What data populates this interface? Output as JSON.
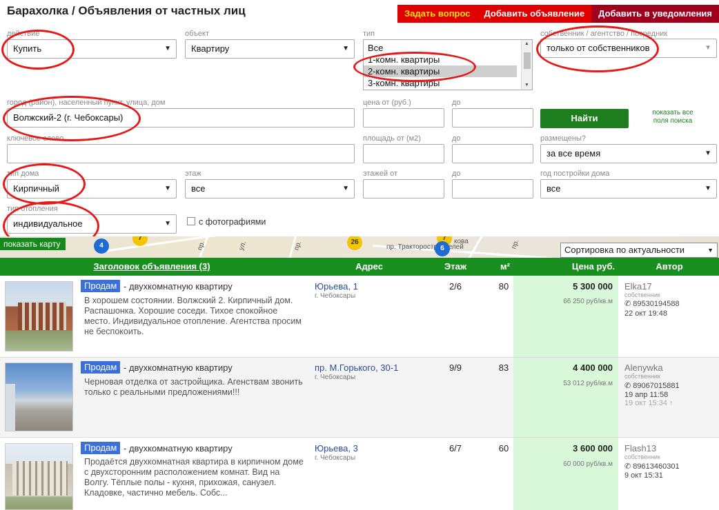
{
  "header": {
    "title": "Барахолка / Объявления от частных лиц",
    "buttons": {
      "ask": "Задать вопрос",
      "add": "Добавить объявление",
      "notify": "Добавить в уведомления"
    }
  },
  "filters": {
    "action": {
      "label": "действие",
      "value": "Купить"
    },
    "object": {
      "label": "объект",
      "value": "Квартиру"
    },
    "type": {
      "label": "тип",
      "options": [
        "Все",
        "1-комн. квартиры",
        "2-комн. квартиры",
        "3-комн. квартиры"
      ],
      "highlighted": "2-комн. квартиры"
    },
    "owner": {
      "label": "собственник / агентство / посредник",
      "value": "только от собственников"
    },
    "city": {
      "label": "город (район), населенный пункт, улица, дом",
      "value": "Волжский-2 (г. Чебоксары)"
    },
    "price_from": {
      "label": "цена от (руб.)",
      "value": ""
    },
    "price_to": {
      "label": "до",
      "value": ""
    },
    "find_button": "Найти",
    "show_all": "показать все поля поиска",
    "keyword": {
      "label": "ключевое слово",
      "value": ""
    },
    "area_from": {
      "label": "площадь от (м2)",
      "value": ""
    },
    "area_to": {
      "label": "до",
      "value": ""
    },
    "posted": {
      "label": "размещены?",
      "value": "за все время"
    },
    "house_type": {
      "label": "тип дома",
      "value": "Кирпичный"
    },
    "floor": {
      "label": "этаж",
      "value": "все"
    },
    "floors_from": {
      "label": "этажей от",
      "value": ""
    },
    "floors_to": {
      "label": "до",
      "value": ""
    },
    "build_year": {
      "label": "год постройки дома",
      "value": "все"
    },
    "heating": {
      "label": "тип отопления",
      "value": "индивидуальное"
    },
    "with_photos": "с фотографиями"
  },
  "map": {
    "show_button": "показать карту",
    "clusters": [
      "4",
      "7",
      "26",
      "7",
      "6"
    ],
    "street_labels": [
      "пр.",
      "ул.",
      "пр.",
      "пр. Тракторостроителей",
      "кова",
      "пр."
    ]
  },
  "sort": {
    "value": "Сортировка по актуальности"
  },
  "table": {
    "headers": {
      "title": "Заголовок объявления (3)",
      "address": "Адрес",
      "floor": "Этаж",
      "area": "м²",
      "price": "Цена руб.",
      "author": "Автор"
    },
    "rows": [
      {
        "tag": "Продам",
        "title": "- двухкомнатную квартиру",
        "desc": "В хорошем состоянии. Волжский 2. Кирпичный дом. Распашонка. Хорошие соседи. Тихое спокойное место. Индивидуальное отопление. Агентства просим не беспокоить.",
        "address": "Юрьева, 1",
        "city": "г. Чебоксары",
        "floor": "2/6",
        "area": "80",
        "price": "5 300 000",
        "ppm": "66 250 руб/кв.м",
        "author": "Elka17",
        "role": "собственник",
        "phone": "89530194588",
        "date": "22 окт 19:48",
        "date2": ""
      },
      {
        "tag": "Продам",
        "title": "- двухкомнатную квартиру",
        "desc": "Черновая отделка от застройщика. Агенствам звонить только с реальными предложениями!!!",
        "address": "пр. М.Горького, 30-1",
        "city": "г. Чебоксары",
        "floor": "9/9",
        "area": "83",
        "price": "4 400 000",
        "ppm": "53 012 руб/кв.м",
        "author": "Alenywka",
        "role": "собственник",
        "phone": "89067015881",
        "date": "19 апр 11:58",
        "date2": "19 окт 15:34 ↑"
      },
      {
        "tag": "Продам",
        "title": "- двухкомнатную квартиру",
        "desc": "Продаётся двухкомнатная квартира в кирпичном доме с двухсторонним расположением комнат. Вид на Волгу. Тёплые полы - кухня, прихожая, санузел. Кладовке, частично мебель. Собс...",
        "address": "Юрьева, 3",
        "city": "г. Чебоксары",
        "floor": "6/7",
        "area": "60",
        "price": "3 600 000",
        "ppm": "60 000 руб/кв.м",
        "author": "Flash13",
        "role": "собственник",
        "phone": "89613460301",
        "date": "9 окт 15:31",
        "date2": ""
      }
    ]
  }
}
